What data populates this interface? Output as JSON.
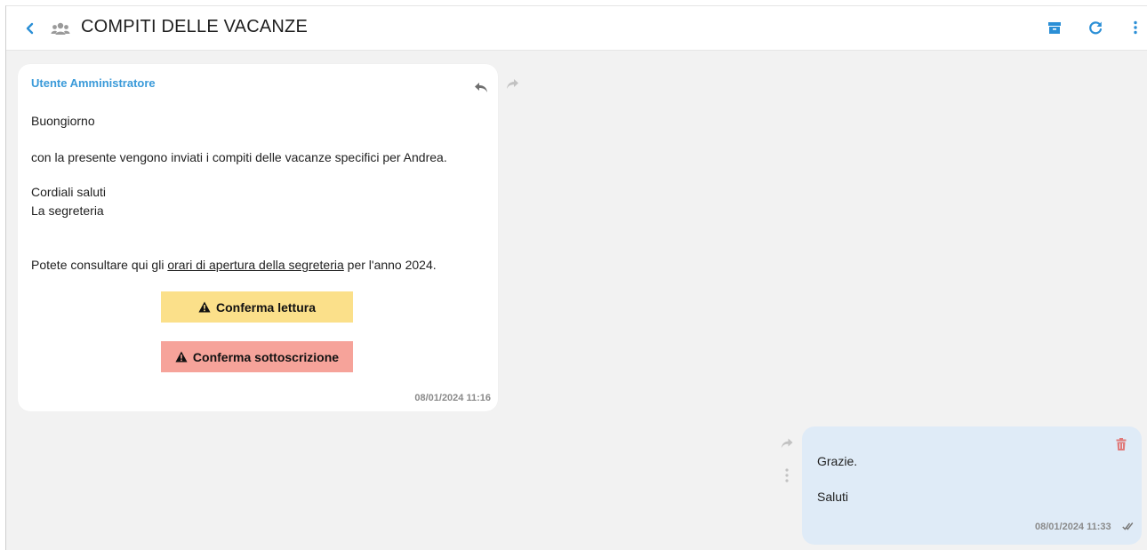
{
  "header": {
    "title": "COMPITI DELLE VACANZE",
    "icons": [
      "back-icon",
      "group-icon",
      "archive-icon",
      "refresh-icon",
      "kebab-menu-icon"
    ],
    "accent_color": "#2b8fd6"
  },
  "incoming_message": {
    "sender": "Utente Amministratore",
    "greeting": "Buongiorno",
    "body": "con la presente vengono inviati i compiti delle vacanze specifici per Andrea.",
    "closing_1": "Cordiali saluti",
    "closing_2": "La segreteria",
    "info_prefix": "Potete consultare qui gli ",
    "info_link": "orari di apertura della segreteria",
    "info_suffix": " per l'anno 2024.",
    "confirm_read_label": "Conferma lettura",
    "confirm_sign_label": "Conferma sottoscrizione",
    "timestamp": "08/01/2024 11:16",
    "confirm_read_color": "#fbe08a",
    "confirm_sign_color": "#f6a39a"
  },
  "outgoing_message": {
    "line_1": "Grazie.",
    "line_2": "Saluti",
    "timestamp": "08/01/2024 11:33",
    "bubble_color": "#dfebf7"
  }
}
